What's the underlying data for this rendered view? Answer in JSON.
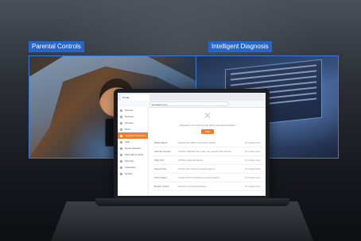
{
  "labels": {
    "left": "Parental Controls",
    "right": "Intelligent Diagnosis"
  },
  "browser": {
    "tab_title": "Tenda",
    "url": "tendawifi.com/..."
  },
  "sidebar": {
    "items": [
      {
        "label": "Internet",
        "active": false
      },
      {
        "label": "Network",
        "active": false
      },
      {
        "label": "Devices",
        "active": false
      },
      {
        "label": "Wi-Fi",
        "active": false
      },
      {
        "label": "Intelligent Diagnosis",
        "active": true
      },
      {
        "label": "VPN",
        "active": false
      },
      {
        "label": "Guest Network",
        "active": false
      },
      {
        "label": "Parental Controls",
        "active": false
      },
      {
        "label": "Security",
        "active": false
      },
      {
        "label": "Advanced",
        "active": false
      },
      {
        "label": "System",
        "active": false
      }
    ]
  },
  "diagnosis": {
    "notice": "Diagnose your network and detect potential problems",
    "start_label": "Start",
    "rows": [
      {
        "name": "WAN Status",
        "desc": "Checks the WAN connection status",
        "status": "Not diagnosed"
      },
      {
        "name": "Internet Access",
        "desc": "Checks whether the router can access the internet",
        "status": "Not diagnosed"
      },
      {
        "name": "Ping Test",
        "desc": "Checks network latency",
        "status": "Not diagnosed"
      },
      {
        "name": "Speed Test",
        "desc": "Checks the current network speed",
        "status": "Not diagnosed"
      },
      {
        "name": "Wi-Fi Status",
        "desc": "Checks Wi-Fi interference and channel",
        "status": "Not diagnosed"
      },
      {
        "name": "Device Check",
        "desc": "Checks connected devices",
        "status": "Not diagnosed"
      }
    ]
  },
  "colors": {
    "accent": "#ef7d2d",
    "label_bg": "#2466c9",
    "panel_border": "#3d7ad6"
  }
}
